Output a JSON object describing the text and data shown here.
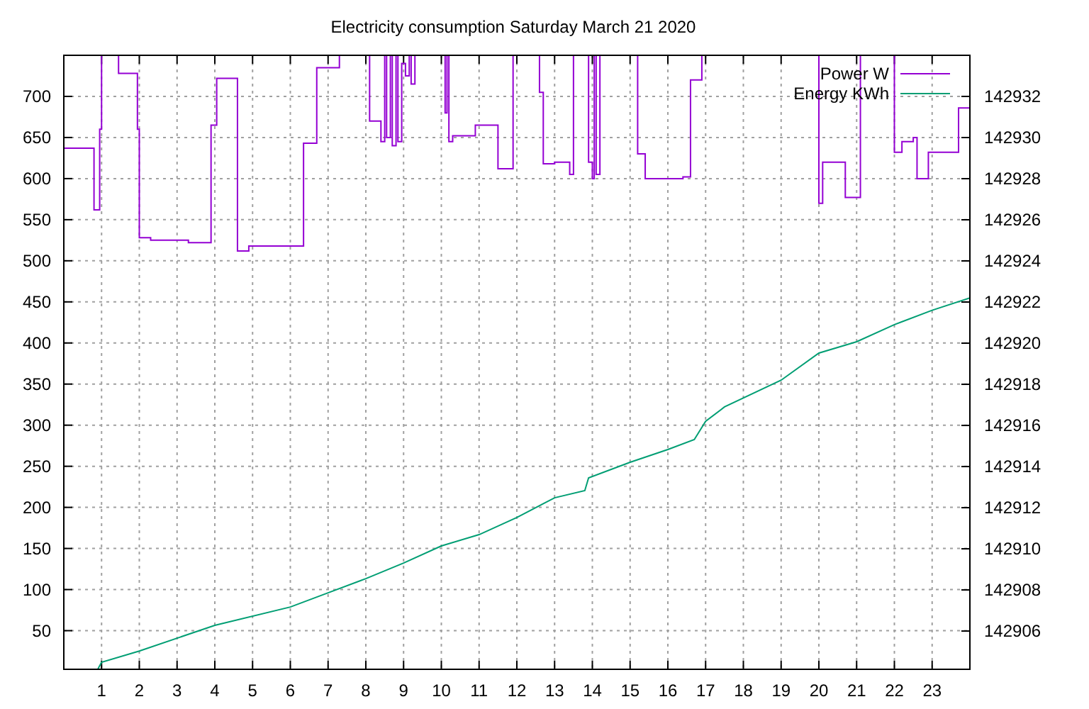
{
  "chart": {
    "chart_data": {
      "type": "line",
      "title": "Electricity consumption Saturday March 21 2020",
      "xlim": [
        0,
        24
      ],
      "ylim": [
        3,
        750
      ],
      "y2lim": [
        142904.14,
        142934
      ],
      "grid": true,
      "legend": true,
      "xticks": [
        1,
        2,
        3,
        4,
        5,
        6,
        7,
        8,
        9,
        10,
        11,
        12,
        13,
        14,
        15,
        16,
        17,
        18,
        19,
        20,
        21,
        22,
        23
      ],
      "yticks": [
        50,
        100,
        150,
        200,
        250,
        300,
        350,
        400,
        450,
        500,
        550,
        600,
        650,
        700
      ],
      "y2ticks": [
        142906,
        142908,
        142910,
        142912,
        142914,
        142916,
        142918,
        142920,
        142922,
        142924,
        142926,
        142928,
        142930,
        142932
      ],
      "series": [
        {
          "name": "Power W",
          "color": "#9400d3",
          "axis": "y",
          "x": [
            0,
            0.8,
            0.8,
            0.95,
            0.95,
            1.0,
            null,
            1.45,
            1.95,
            1.95,
            2.0,
            2.0,
            2.3,
            2.3,
            3.3,
            3.3,
            3.9,
            3.9,
            4.05,
            4.05,
            4.6,
            4.6,
            4.9,
            4.9,
            6.35,
            6.35,
            6.7,
            6.7,
            7.3,
            null,
            8.1,
            8.4,
            8.4,
            8.5,
            null,
            8.55,
            8.65,
            null,
            8.7,
            8.8,
            null,
            8.85,
            8.95,
            8.95,
            9.05,
            9.05,
            9.15,
            null,
            9.2,
            9.3,
            null,
            10.1,
            10.15,
            null,
            10.2,
            10.3,
            10.3,
            10.9,
            10.9,
            11.5,
            11.5,
            11.9,
            null,
            12.6,
            12.7,
            12.7,
            13.0,
            13.0,
            13.4,
            13.4,
            13.5,
            null,
            13.9,
            14.0,
            14.0,
            14.05,
            null,
            14.1,
            14.2,
            null,
            15.2,
            15.4,
            15.4,
            16.4,
            16.4,
            16.6,
            16.6,
            16.9,
            null,
            20.0,
            20.1,
            20.1,
            20.7,
            20.7,
            21.1,
            null,
            22.0,
            22.2,
            22.2,
            22.5,
            22.5,
            22.6,
            22.6,
            22.9,
            22.9,
            23.7,
            23.7,
            24
          ],
          "values": [
            637,
            637,
            562,
            562,
            660,
            660,
            null,
            728,
            728,
            660,
            660,
            528,
            528,
            525,
            525,
            522,
            522,
            665,
            665,
            722,
            722,
            512,
            512,
            518,
            518,
            643,
            643,
            735,
            735,
            null,
            670,
            670,
            645,
            645,
            null,
            650,
            650,
            null,
            640,
            640,
            null,
            645,
            645,
            740,
            740,
            725,
            725,
            null,
            715,
            715,
            null,
            680,
            680,
            null,
            645,
            645,
            652,
            652,
            665,
            665,
            612,
            612,
            null,
            705,
            705,
            618,
            618,
            620,
            620,
            605,
            605,
            null,
            620,
            620,
            600,
            600,
            null,
            605,
            605,
            null,
            630,
            630,
            600,
            600,
            602,
            602,
            720,
            720,
            null,
            570,
            570,
            620,
            620,
            577,
            577,
            null,
            632,
            632,
            645,
            645,
            650,
            650,
            600,
            600,
            632,
            632,
            686,
            686
          ]
        },
        {
          "name": "Energy KWh",
          "color": "#009e73",
          "axis": "y2",
          "x": [
            0.9,
            1,
            2,
            4,
            6,
            7,
            8,
            9,
            10,
            11,
            12,
            13,
            13.8,
            13.9,
            15,
            16,
            16.7,
            17,
            17.5,
            19,
            20,
            21,
            22,
            23,
            24
          ],
          "values": [
            142904.14,
            142904.48,
            142905.03,
            142906.28,
            142907.17,
            142907.86,
            142908.55,
            142909.31,
            142910.14,
            142910.69,
            142911.52,
            142912.48,
            142912.83,
            142913.45,
            142914.21,
            142914.83,
            142915.31,
            142916.2,
            142916.9,
            142918.2,
            142919.52,
            142920.07,
            142920.9,
            142921.6,
            142922.2
          ]
        }
      ]
    }
  }
}
